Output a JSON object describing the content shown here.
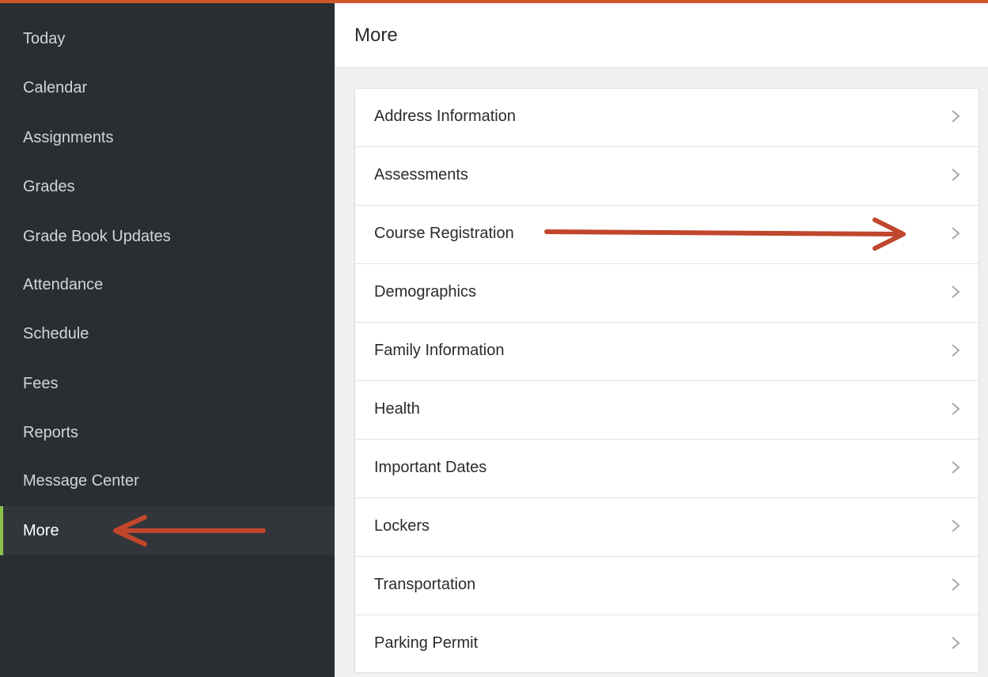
{
  "sidebar": {
    "items": [
      {
        "label": "Today"
      },
      {
        "label": "Calendar"
      },
      {
        "label": "Assignments"
      },
      {
        "label": "Grades"
      },
      {
        "label": "Grade Book Updates"
      },
      {
        "label": "Attendance"
      },
      {
        "label": "Schedule"
      },
      {
        "label": "Fees"
      },
      {
        "label": "Reports"
      },
      {
        "label": "Message Center"
      },
      {
        "label": "More",
        "active": true
      }
    ]
  },
  "header": {
    "title": "More"
  },
  "menu": {
    "items": [
      {
        "label": "Address Information",
        "icon": "chevron-right-icon"
      },
      {
        "label": "Assessments",
        "icon": "chevron-right-icon"
      },
      {
        "label": "Course Registration",
        "icon": "chevron-right-icon"
      },
      {
        "label": "Demographics",
        "icon": "chevron-right-icon"
      },
      {
        "label": "Family Information",
        "icon": "chevron-right-icon"
      },
      {
        "label": "Health",
        "icon": "chevron-right-icon"
      },
      {
        "label": "Important Dates",
        "icon": "chevron-right-icon"
      },
      {
        "label": "Lockers",
        "icon": "chevron-right-icon"
      },
      {
        "label": "Transportation",
        "icon": "chevron-right-icon"
      },
      {
        "label": "Parking Permit",
        "icon": "chevron-right-icon"
      }
    ]
  },
  "colors": {
    "accent_top": "#d0562a",
    "sidebar_bg": "#2a2e33",
    "active_marker": "#8bc34a",
    "annotation_arrow": "#c0462c"
  }
}
